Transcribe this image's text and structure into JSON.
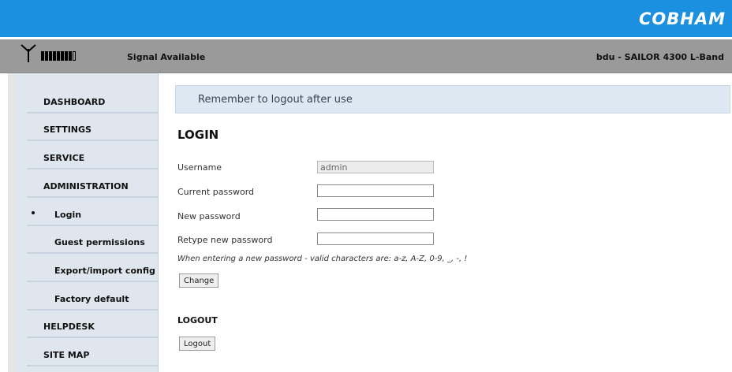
{
  "header": {
    "brand": "COBHAM",
    "signal_text": "Signal Available",
    "device_text": "bdu - SAILOR 4300 L-Band",
    "signal_bars_filled": 8,
    "signal_bars_total": 9
  },
  "sidebar": {
    "items": [
      {
        "label": "DASHBOARD"
      },
      {
        "label": "SETTINGS"
      },
      {
        "label": "SERVICE"
      },
      {
        "label": "ADMINISTRATION"
      },
      {
        "label": "Login",
        "current": true
      },
      {
        "label": "Guest permissions"
      },
      {
        "label": "Export/import config"
      },
      {
        "label": "Factory default"
      },
      {
        "label": "HELPDESK"
      },
      {
        "label": "SITE MAP"
      }
    ]
  },
  "main": {
    "notice": "Remember to logout after use",
    "login_title": "LOGIN",
    "fields": {
      "username": {
        "label": "Username",
        "value": "admin"
      },
      "current_password": {
        "label": "Current password",
        "value": ""
      },
      "new_password": {
        "label": "New password",
        "value": ""
      },
      "retype_password": {
        "label": "Retype new password",
        "value": ""
      }
    },
    "hint": "When entering a new password - valid characters are: a-z, A-Z, 0-9, _, -, !",
    "change_button": "Change",
    "logout_title": "LOGOUT",
    "logout_button": "Logout"
  }
}
